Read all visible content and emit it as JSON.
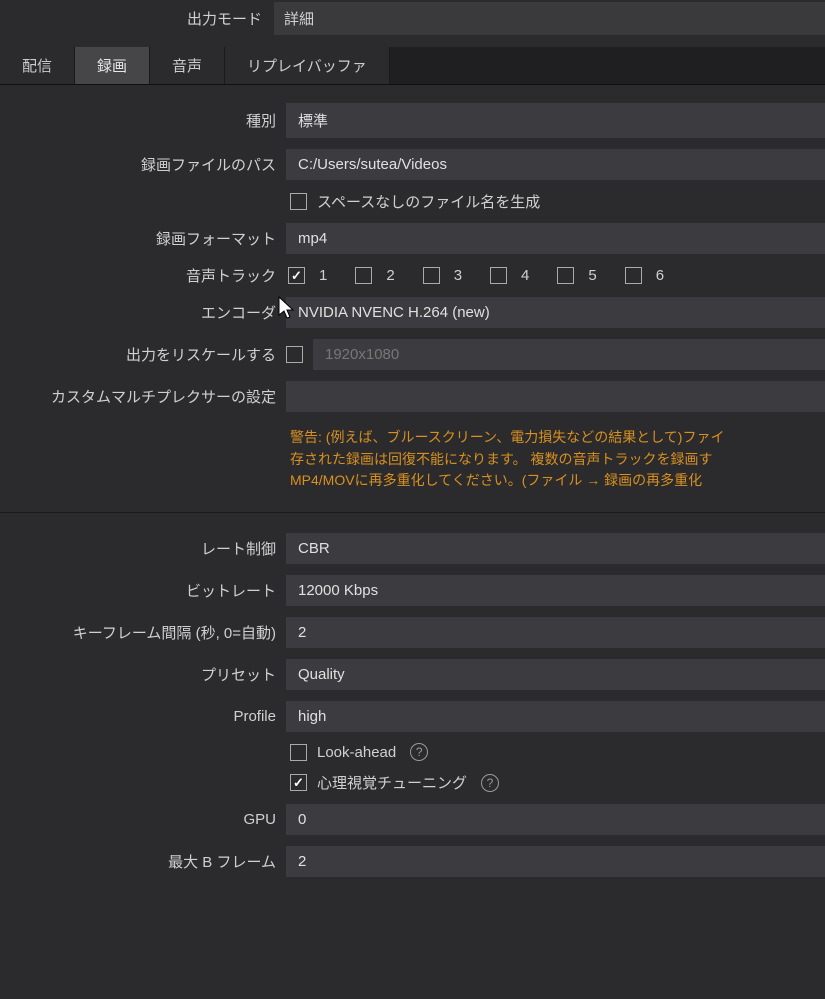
{
  "header": {
    "output_mode_label": "出力モード",
    "output_mode_value": "詳細"
  },
  "tabs": [
    {
      "label": "配信"
    },
    {
      "label": "録画"
    },
    {
      "label": "音声"
    },
    {
      "label": "リプレイバッファ"
    }
  ],
  "recording": {
    "type_label": "種別",
    "type_value": "標準",
    "path_label": "録画ファイルのパス",
    "path_value": "C:/Users/sutea/Videos",
    "nospace_label": "スペースなしのファイル名を生成",
    "format_label": "録画フォーマット",
    "format_value": "mp4",
    "tracks_label": "音声トラック",
    "tracks": [
      "1",
      "2",
      "3",
      "4",
      "5",
      "6"
    ],
    "encoder_label": "エンコーダ",
    "encoder_value": "NVIDIA NVENC H.264 (new)",
    "rescale_label": "出力をリスケールする",
    "rescale_placeholder": "1920x1080",
    "mux_label": "カスタムマルチプレクサーの設定",
    "warning_l1": "警告: (例えば、ブルースクリーン、電力損失などの結果として)ファイ",
    "warning_l2": "存された録画は回復不能になります。 複数の音声トラックを録画す",
    "warning_l3": "MP4/MOVに再多重化してください。(ファイル → 録画の再多重化"
  },
  "encoder": {
    "rate_label": "レート制御",
    "rate_value": "CBR",
    "bitrate_label": "ビットレート",
    "bitrate_value": "12000 Kbps",
    "keyframe_label": "キーフレーム間隔 (秒, 0=自動)",
    "keyframe_value": "2",
    "preset_label": "プリセット",
    "preset_value": "Quality",
    "profile_label": "Profile",
    "profile_value": "high",
    "lookahead_label": "Look-ahead",
    "psycho_label": "心理視覚チューニング",
    "gpu_label": "GPU",
    "gpu_value": "0",
    "bframes_label": "最大 B フレーム",
    "bframes_value": "2"
  }
}
